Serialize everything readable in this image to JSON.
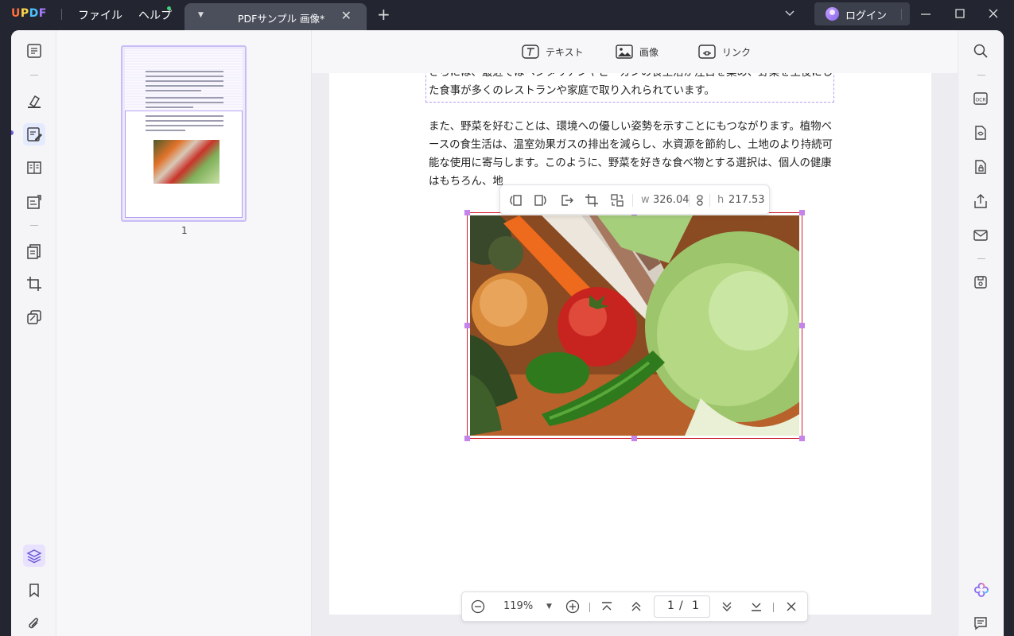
{
  "app": {
    "logo": "UPDF"
  },
  "menu": {
    "file": "ファイル",
    "help": "ヘルプ"
  },
  "tab": {
    "title": "PDFサンプル 画像*"
  },
  "account": {
    "login_label": "ログイン"
  },
  "edit_toolbar": {
    "text_label": "テキスト",
    "image_label": "画像",
    "link_label": "リンク"
  },
  "thumbnail": {
    "page_number": "1"
  },
  "document": {
    "para1": [
      "さらには、最近ではベジタリアンやビーガンの食生活が注目を集め、野菜を主役にし",
      "た食事が多くのレストランや家庭で取り入れられています。"
    ],
    "para2": [
      "また、野菜を好むことは、環境への優しい姿勢を示すことにもつながります。植物ベ",
      "ースの食生活は、温室効果ガスの排出を減らし、水資源を節約し、土地のより持続可",
      "能な使用に寄与します。このように、野菜を好きな食べ物とする選択は、個人の健康",
      "はもちろん、地"
    ]
  },
  "image_toolbar": {
    "width_label": "w",
    "width_value": "326.04",
    "height_label": "h",
    "height_value": "217.53"
  },
  "zoom": {
    "value": "119%",
    "current_page": "1",
    "page_sep": "/",
    "total_pages": "1"
  },
  "colors": {
    "accent": "#6a5ad8",
    "selection": "#c484ec",
    "image_border": "#d0202e",
    "titlebar": "#232631"
  }
}
